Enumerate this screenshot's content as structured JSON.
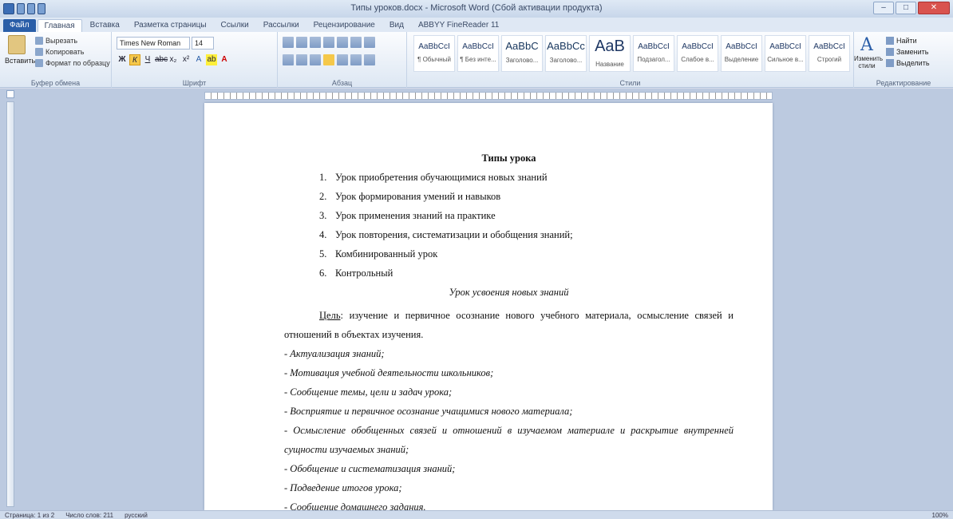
{
  "window": {
    "title": "Типы уроков.docx - Microsoft Word (Сбой активации продукта)"
  },
  "tabs": [
    "Файл",
    "Главная",
    "Вставка",
    "Разметка страницы",
    "Ссылки",
    "Рассылки",
    "Рецензирование",
    "Вид",
    "ABBYY FineReader 11"
  ],
  "ribbon": {
    "clipboard": {
      "paste": "Вставить",
      "cut": "Вырезать",
      "copy": "Копировать",
      "format": "Формат по образцу",
      "label": "Буфер обмена"
    },
    "font": {
      "name": "Times New Roman",
      "size": "14",
      "label": "Шрифт"
    },
    "paragraph": {
      "label": "Абзац"
    },
    "styles": {
      "items": [
        {
          "preview": "AaBbCcI",
          "name": "¶ Обычный"
        },
        {
          "preview": "AaBbCcI",
          "name": "¶ Без инте..."
        },
        {
          "preview": "AaBbC",
          "name": "Заголово..."
        },
        {
          "preview": "AaBbCc",
          "name": "Заголово..."
        },
        {
          "preview": "AaB",
          "name": "Название"
        },
        {
          "preview": "AaBbCcI",
          "name": "Подзагол..."
        },
        {
          "preview": "AaBbCcI",
          "name": "Слабое в..."
        },
        {
          "preview": "AaBbCcI",
          "name": "Выделение"
        },
        {
          "preview": "AaBbCcI",
          "name": "Сильное в..."
        },
        {
          "preview": "AaBbCcI",
          "name": "Строгий"
        }
      ],
      "change": "Изменить стили",
      "label": "Стили"
    },
    "editing": {
      "find": "Найти",
      "replace": "Заменить",
      "select": "Выделить",
      "label": "Редактирование"
    }
  },
  "document": {
    "title": "Типы урока",
    "list": [
      {
        "num": "1.",
        "text": "Урок приобретения обучающимися новых знаний"
      },
      {
        "num": "2.",
        "text": "Урок формирования умений и навыков"
      },
      {
        "num": "3.",
        "text": "Урок применения знаний на практике"
      },
      {
        "num": "4.",
        "text": "Урок повторения, систематизации и обобщения знаний;"
      },
      {
        "num": "5.",
        "text": "Комбинированный урок"
      },
      {
        "num": "6.",
        "text": "Контрольный"
      }
    ],
    "subtitle": "Урок усвоения новых знаний",
    "goal_label": "Цель",
    "goal_text": ": изучение и первичное осознание нового учебного материала, осмысление связей и отношений в объектах изучения.",
    "lines": [
      "- Актуализация знаний;",
      "- Мотивация учебной деятельности школьников;",
      "- Сообщение темы, цели и задач урока;",
      "- Восприятие и первичное осознание учащимися нового материала;",
      "- Осмысление обобщенных связей и отношений в изучаемом материале и раскрытие внутренней сущности изучаемых знаний;",
      "- Обобщение и систематизация знаний;",
      "- Подведение итогов урока;",
      "- Сообщение домашнего задания."
    ]
  },
  "statusbar": {
    "page": "Страница: 1 из 2",
    "words": "Число слов: 211",
    "lang": "русский",
    "zoom": "100%"
  }
}
